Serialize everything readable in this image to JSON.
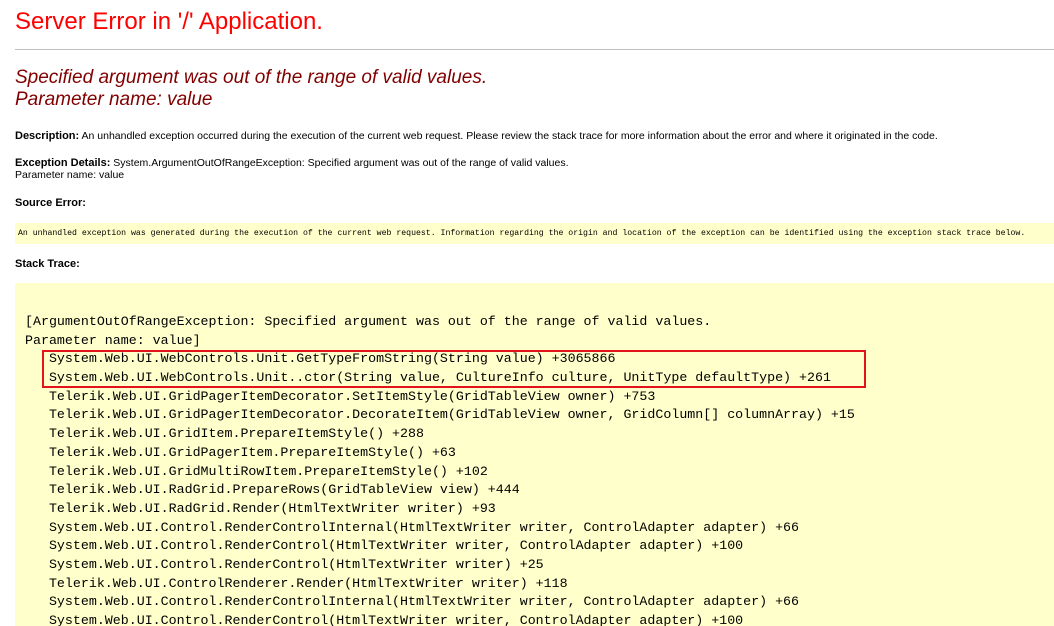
{
  "title": "Server Error in '/' Application.",
  "error": {
    "message_line1": "Specified argument was out of the range of valid values.",
    "message_line2": "Parameter name: value"
  },
  "description": {
    "label": "Description:",
    "text": " An unhandled exception occurred during the execution of the current web request. Please review the stack trace for more information about the error and where it originated in the code."
  },
  "exception_details": {
    "label": "Exception Details:",
    "text": " System.ArgumentOutOfRangeException: Specified argument was out of the range of valid values.",
    "line2": "Parameter name: value"
  },
  "source_error": {
    "label": "Source Error:",
    "text": "An unhandled exception was generated during the execution of the current web request. Information regarding the origin and location of the exception can be identified using the exception stack trace below."
  },
  "stack_trace": {
    "label": "Stack Trace:",
    "lines": [
      "[ArgumentOutOfRangeException: Specified argument was out of the range of valid values.",
      "Parameter name: value]",
      "   System.Web.UI.WebControls.Unit.GetTypeFromString(String value) +3065866",
      "   System.Web.UI.WebControls.Unit..ctor(String value, CultureInfo culture, UnitType defaultType) +261",
      "   Telerik.Web.UI.GridPagerItemDecorator.SetItemStyle(GridTableView owner) +753",
      "   Telerik.Web.UI.GridPagerItemDecorator.DecorateItem(GridTableView owner, GridColumn[] columnArray) +15",
      "   Telerik.Web.UI.GridItem.PrepareItemStyle() +288",
      "   Telerik.Web.UI.GridPagerItem.PrepareItemStyle() +63",
      "   Telerik.Web.UI.GridMultiRowItem.PrepareItemStyle() +102",
      "   Telerik.Web.UI.RadGrid.PrepareRows(GridTableView view) +444",
      "   Telerik.Web.UI.RadGrid.Render(HtmlTextWriter writer) +93",
      "   System.Web.UI.Control.RenderControlInternal(HtmlTextWriter writer, ControlAdapter adapter) +66",
      "   System.Web.UI.Control.RenderControl(HtmlTextWriter writer, ControlAdapter adapter) +100",
      "   System.Web.UI.Control.RenderControl(HtmlTextWriter writer) +25",
      "   Telerik.Web.UI.ControlRenderer.Render(HtmlTextWriter writer) +118",
      "   System.Web.UI.Control.RenderControlInternal(HtmlTextWriter writer, ControlAdapter adapter) +66",
      "   System.Web.UI.Control.RenderControl(HtmlTextWriter writer, ControlAdapter adapter) +100"
    ]
  },
  "colors": {
    "title": "#ff0000",
    "error_message": "#800000",
    "code_background": "#ffffcc",
    "highlight_border": "#e0141a"
  }
}
